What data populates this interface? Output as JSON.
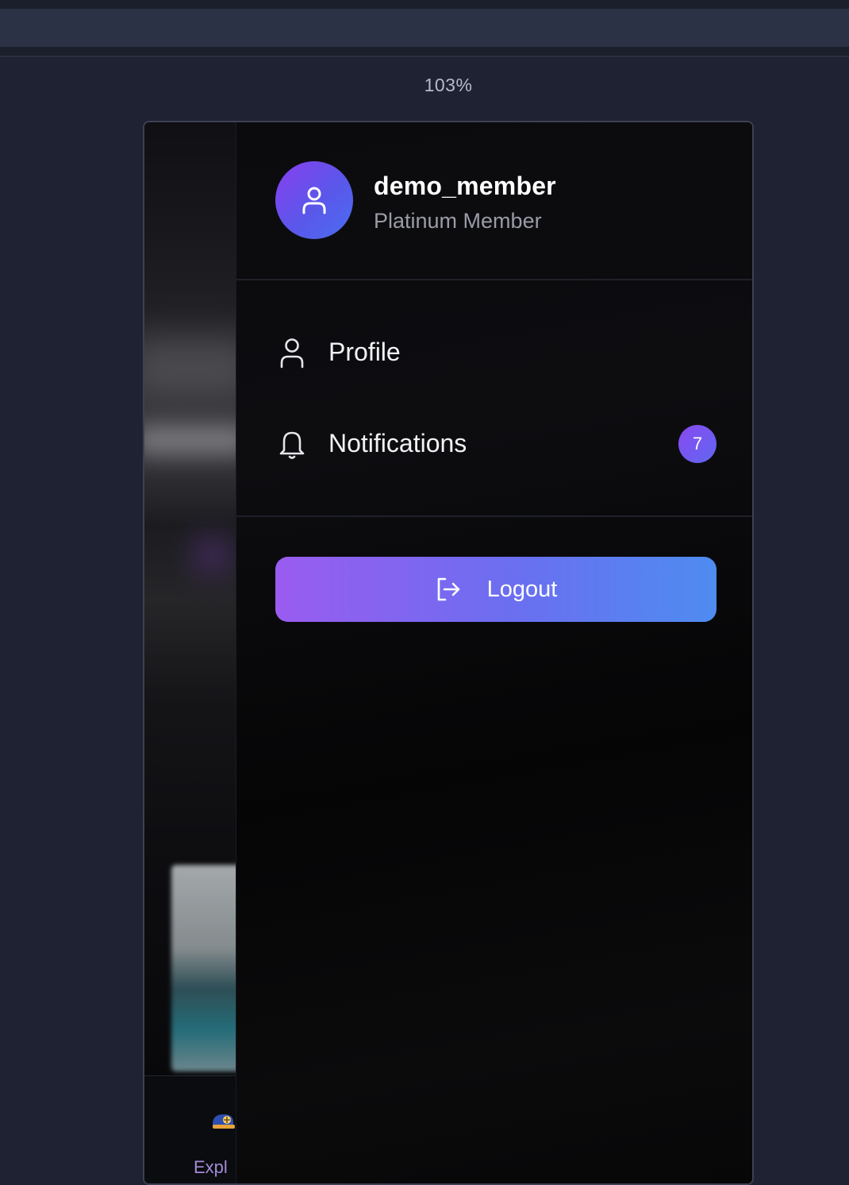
{
  "browser": {
    "zoom_label": "103%"
  },
  "background_app": {
    "tab_label": "Expl"
  },
  "drawer": {
    "user": {
      "username": "demo_member",
      "tier": "Platinum Member",
      "avatar_icon": "user-icon"
    },
    "menu": [
      {
        "label": "Profile",
        "icon": "user-icon"
      },
      {
        "label": "Notifications",
        "icon": "bell-icon",
        "badge": "7"
      }
    ],
    "logout": {
      "label": "Logout",
      "icon": "logout-icon"
    }
  },
  "colors": {
    "accent_start": "#9a5cf0",
    "accent_end": "#4e8cf0",
    "page_bg": "#1e2233",
    "drawer_bg": "#0a0a0d"
  }
}
